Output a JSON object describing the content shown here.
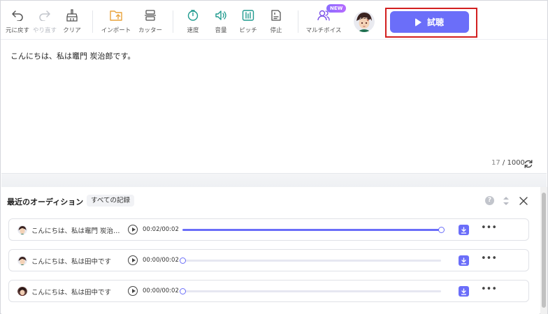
{
  "toolbar": {
    "undo": "元に戻す",
    "redo": "やり直す",
    "clear": "クリア",
    "import": "インポート",
    "cutter": "カッター",
    "speed": "速度",
    "volume": "音量",
    "pitch": "ピッチ",
    "pause": "停止",
    "multi_voice": "マルチボイス",
    "new_badge": "NEW",
    "play_label": "試聴"
  },
  "editor": {
    "text": "こんにちは、私は竈門 炭治郎です。",
    "char_count": "17",
    "char_limit": "/ 1000"
  },
  "history": {
    "title": "最近のオーディション",
    "all_records": "すべての記録",
    "help": "?",
    "items": [
      {
        "text": "こんにちは、私は竈門 炭治郎...",
        "time": "00:02/00:02",
        "progress": 1.0
      },
      {
        "text": "こんにちは、私は田中です",
        "time": "00:00/00:02",
        "progress": 0.0
      },
      {
        "text": "こんにちは、私は田中です",
        "time": "00:00/00:02",
        "progress": 0.0
      }
    ]
  },
  "colors": {
    "accent": "#6b6ef9",
    "highlight": "#d21f1f"
  }
}
